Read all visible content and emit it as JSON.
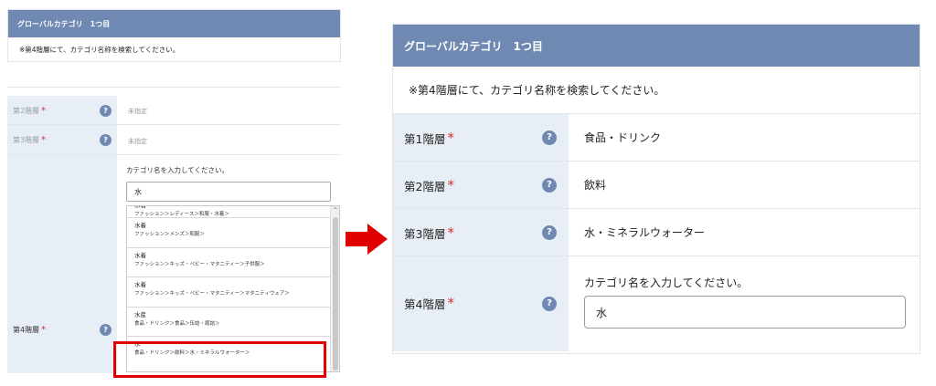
{
  "left": {
    "header": "グローバルカテゴリ　1つ目",
    "note": "※第4階層にて、カテゴリ名称を検索してください。",
    "rows": [
      {
        "label": "第2階層",
        "value": "未指定"
      },
      {
        "label": "第3階層",
        "value": "未指定"
      },
      {
        "label": "第4階層"
      }
    ],
    "required_mark": "*",
    "help_icon": "?",
    "prompt": "カテゴリ名を入力してください。",
    "input_value": "水",
    "suggestions": [
      {
        "name": "水着",
        "path": "ファッション＞レディース＞和服・水着＞"
      },
      {
        "name": "水着",
        "path": "ファッション＞メンズ＞和服＞"
      },
      {
        "name": "水着",
        "path": "ファッション＞キッズ・ベビー・マタニティー＞子供服＞"
      },
      {
        "name": "水着",
        "path": "ファッション＞キッズ・ベビー・マタニティー＞マタニティウェア＞"
      },
      {
        "name": "水産",
        "path": "食品・ドリンク＞食品＞缶詰・瓶詰＞"
      },
      {
        "name": "水",
        "path": "食品・ドリンク＞飲料＞水・ミネラルウォーター＞"
      }
    ],
    "scroll_up": "^"
  },
  "right": {
    "header": "グローバルカテゴリ　1つ目",
    "note": "※第4階層にて、カテゴリ名称を検索してください。",
    "rows": [
      {
        "label": "第1階層",
        "value": "食品・ドリンク"
      },
      {
        "label": "第2階層",
        "value": "飲料"
      },
      {
        "label": "第3階層",
        "value": "水・ミネラルウォーター"
      },
      {
        "label": "第4階層"
      }
    ],
    "required_mark": "*",
    "help_icon": "?",
    "prompt": "カテゴリ名を入力してください。",
    "input_value": "水"
  },
  "colors": {
    "header_bg": "#6f89b2",
    "label_bg": "#e8eef5",
    "required": "#d23030",
    "highlight": "#e00000",
    "arrow": "#e00000"
  }
}
